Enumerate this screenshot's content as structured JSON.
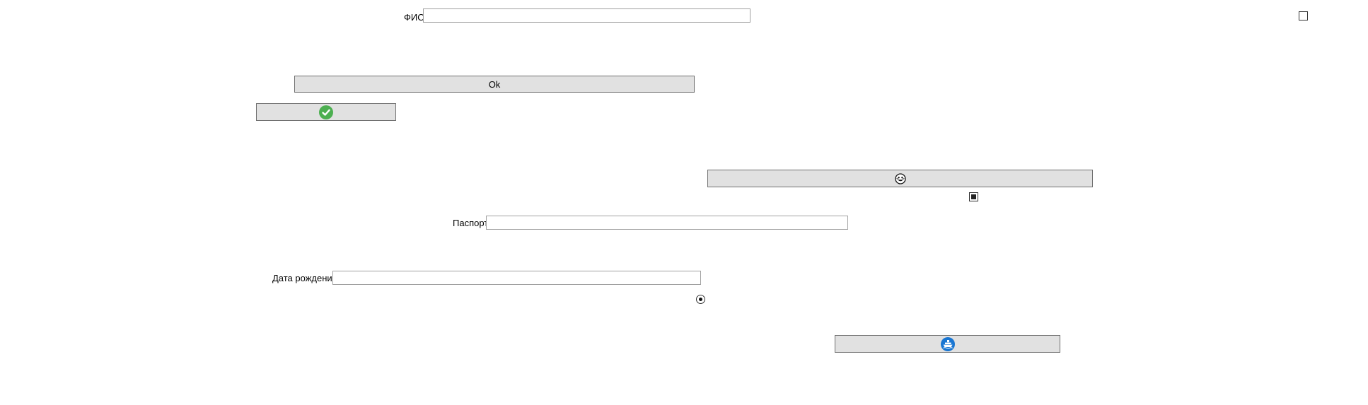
{
  "form": {
    "fio": {
      "label": "ФИО",
      "value": ""
    },
    "passport": {
      "label": "Паспорт",
      "value": ""
    },
    "birth_date": {
      "label": "Дата рождения",
      "value": ""
    }
  },
  "buttons": {
    "ok": {
      "label": "Ok"
    },
    "check": {
      "icon": "check-circle-icon"
    },
    "emoji": {
      "icon": "emoji-face-icon"
    },
    "ship": {
      "icon": "ship-icon"
    }
  },
  "toggles": {
    "top_checkbox": {
      "checked": false
    },
    "mid_checkbox": {
      "checked": true
    },
    "radio": {
      "checked": true
    }
  },
  "colors": {
    "check_icon": "#4caf50",
    "ship_icon": "#1976d2",
    "button_bg": "#e1e1e1"
  }
}
